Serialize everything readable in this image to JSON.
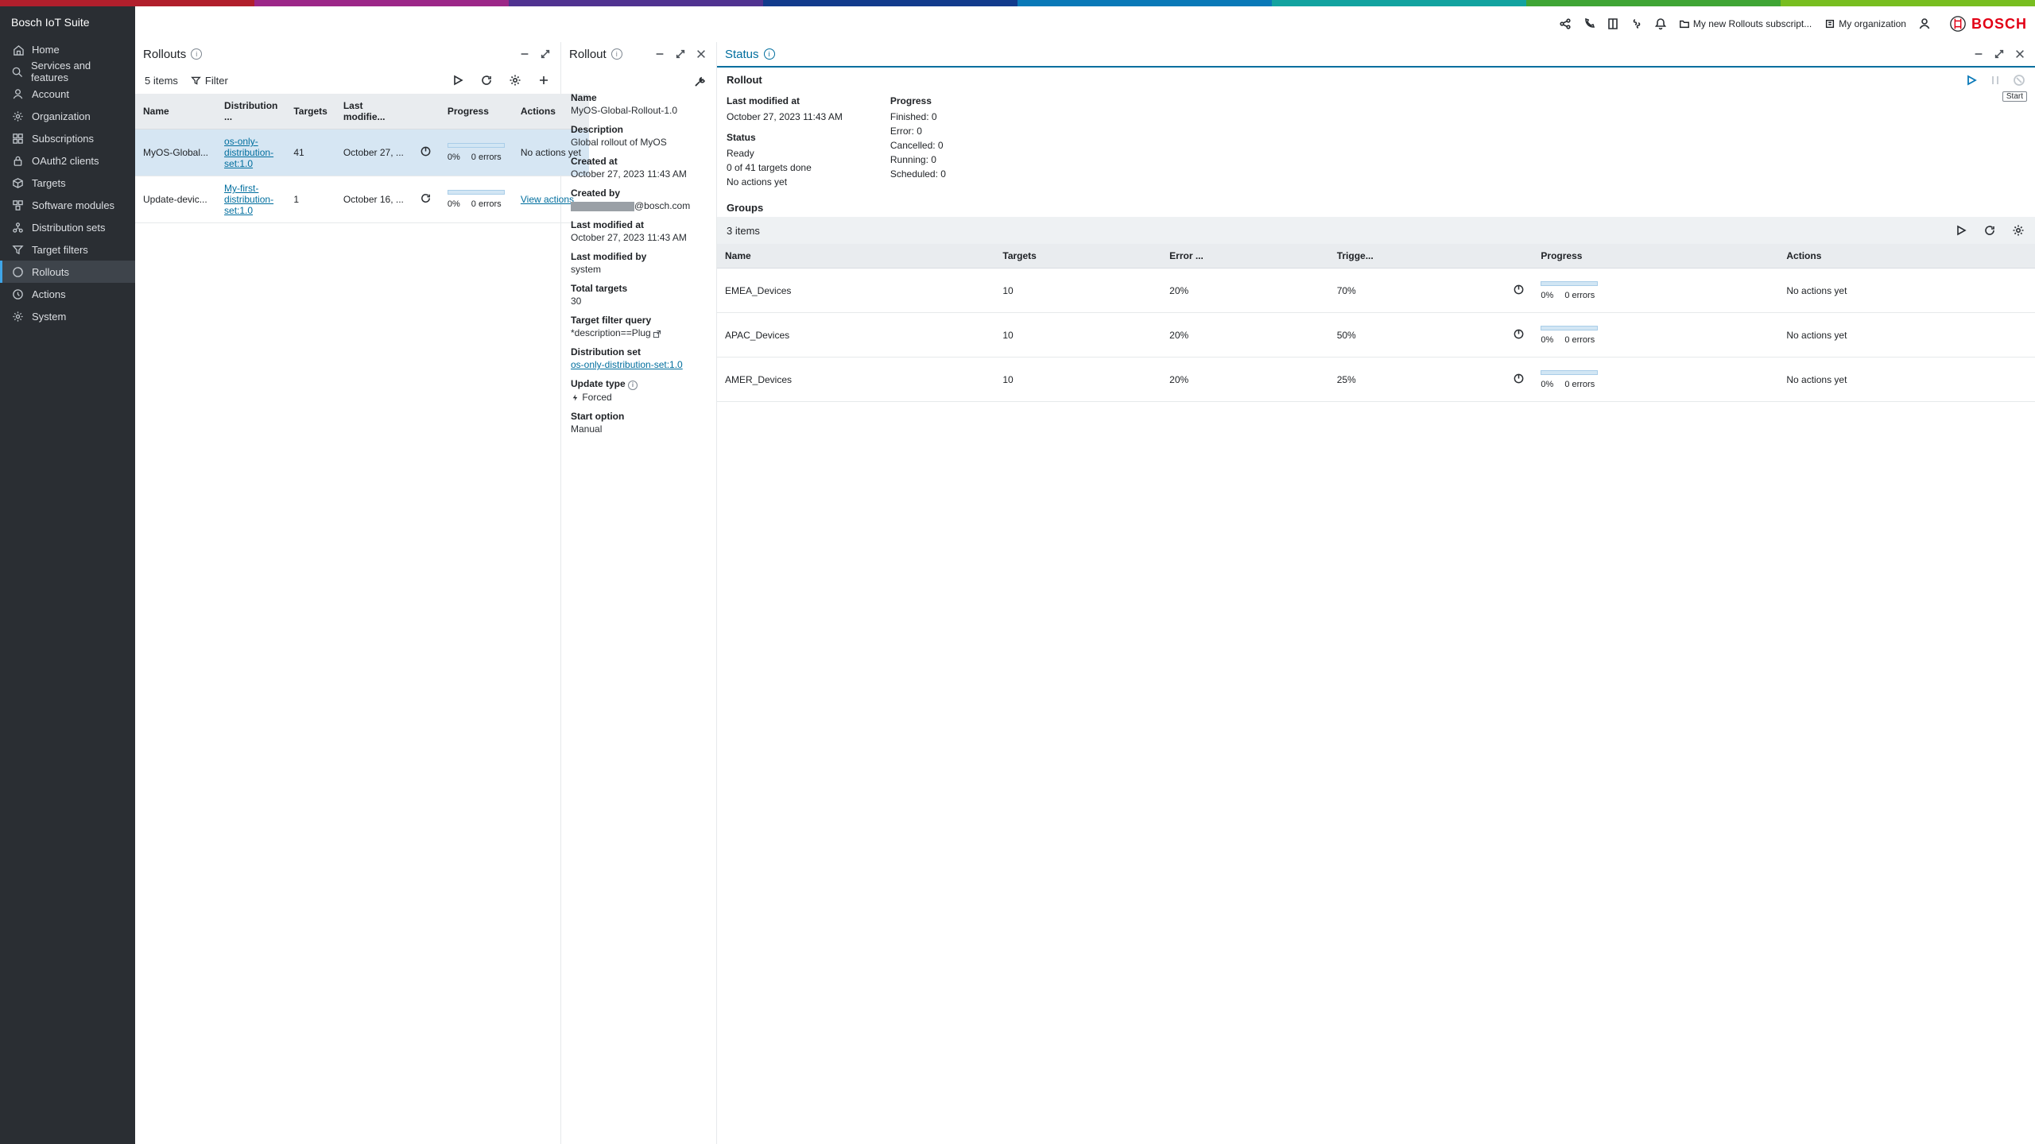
{
  "sidebar": {
    "title": "Bosch IoT Suite",
    "items": [
      {
        "label": "Home",
        "icon": "home"
      },
      {
        "label": "Services and features",
        "icon": "search"
      },
      {
        "label": "Account",
        "icon": "user"
      },
      {
        "label": "Organization",
        "icon": "gear"
      },
      {
        "label": "Subscriptions",
        "icon": "grid"
      },
      {
        "label": "OAuth2 clients",
        "icon": "lock"
      },
      {
        "label": "Targets",
        "icon": "cube"
      },
      {
        "label": "Software modules",
        "icon": "modules"
      },
      {
        "label": "Distribution sets",
        "icon": "distset"
      },
      {
        "label": "Target filters",
        "icon": "funnel"
      },
      {
        "label": "Rollouts",
        "icon": "rollout",
        "active": true
      },
      {
        "label": "Actions",
        "icon": "action"
      },
      {
        "label": "System",
        "icon": "gear"
      }
    ]
  },
  "header": {
    "subscription": "My new Rollouts subscript...",
    "org": "My organization",
    "brand": "BOSCH"
  },
  "rollouts_panel": {
    "title": "Rollouts",
    "count_label": "5 items",
    "filter_label": "Filter",
    "columns": [
      "Name",
      "Distribution ...",
      "Targets",
      "Last modifie...",
      "",
      "Progress",
      "Actions"
    ],
    "rows": [
      {
        "name": "MyOS-Global...",
        "dist": "os-only-distribution-set:1.0",
        "targets": "41",
        "modified": "October 27, ...",
        "status_icon": "power",
        "progress_pct": "0%",
        "progress_err": "0 errors",
        "actions": "No actions yet",
        "actions_link": false,
        "selected": true
      },
      {
        "name": "Update-devic...",
        "dist": "My-first-distribution-set:1.0",
        "targets": "1",
        "modified": "October 16, ...",
        "status_icon": "refresh",
        "progress_pct": "0%",
        "progress_err": "0 errors",
        "actions": "View actions",
        "actions_link": true,
        "selected": false
      }
    ]
  },
  "rollout_panel": {
    "title": "Rollout",
    "fields": {
      "name_label": "Name",
      "name": "MyOS-Global-Rollout-1.0",
      "desc_label": "Description",
      "desc": "Global rollout of MyOS",
      "created_label": "Created at",
      "created": "October 27, 2023 11:43 AM",
      "createdby_label": "Created by",
      "createdby_suffix": "@bosch.com",
      "lastmod_label": "Last modified at",
      "lastmod": "October 27, 2023 11:43 AM",
      "lastmodby_label": "Last modified by",
      "lastmodby": "system",
      "total_label": "Total targets",
      "total": "30",
      "tfq_label": "Target filter query",
      "tfq": "*description==Plug",
      "dist_label": "Distribution set",
      "dist": "os-only-distribution-set:1.0",
      "upd_label": "Update type",
      "upd": "Forced",
      "start_label": "Start option",
      "start": "Manual"
    }
  },
  "status_panel": {
    "title": "Status",
    "section_title": "Rollout",
    "start_chip": "Start",
    "left_col": {
      "lastmod_label": "Last modified at",
      "lastmod": "October 27, 2023 11:43 AM",
      "status_label": "Status",
      "status": "Ready",
      "done": "0 of 41 targets done",
      "noactions": "No actions yet"
    },
    "right_col": {
      "progress_label": "Progress",
      "finished": "Finished: 0",
      "error": "Error: 0",
      "cancelled": "Cancelled: 0",
      "running": "Running: 0",
      "scheduled": "Scheduled: 0"
    },
    "groups_label": "Groups",
    "groups_count": "3 items",
    "group_columns": [
      "Name",
      "Targets",
      "Error ...",
      "Trigge...",
      "",
      "Progress",
      "Actions"
    ],
    "groups": [
      {
        "name": "EMEA_Devices",
        "targets": "10",
        "error": "20%",
        "trigger": "70%",
        "pct": "0%",
        "err": "0 errors",
        "actions": "No actions yet"
      },
      {
        "name": "APAC_Devices",
        "targets": "10",
        "error": "20%",
        "trigger": "50%",
        "pct": "0%",
        "err": "0 errors",
        "actions": "No actions yet"
      },
      {
        "name": "AMER_Devices",
        "targets": "10",
        "error": "20%",
        "trigger": "25%",
        "pct": "0%",
        "err": "0 errors",
        "actions": "No actions yet"
      }
    ]
  }
}
